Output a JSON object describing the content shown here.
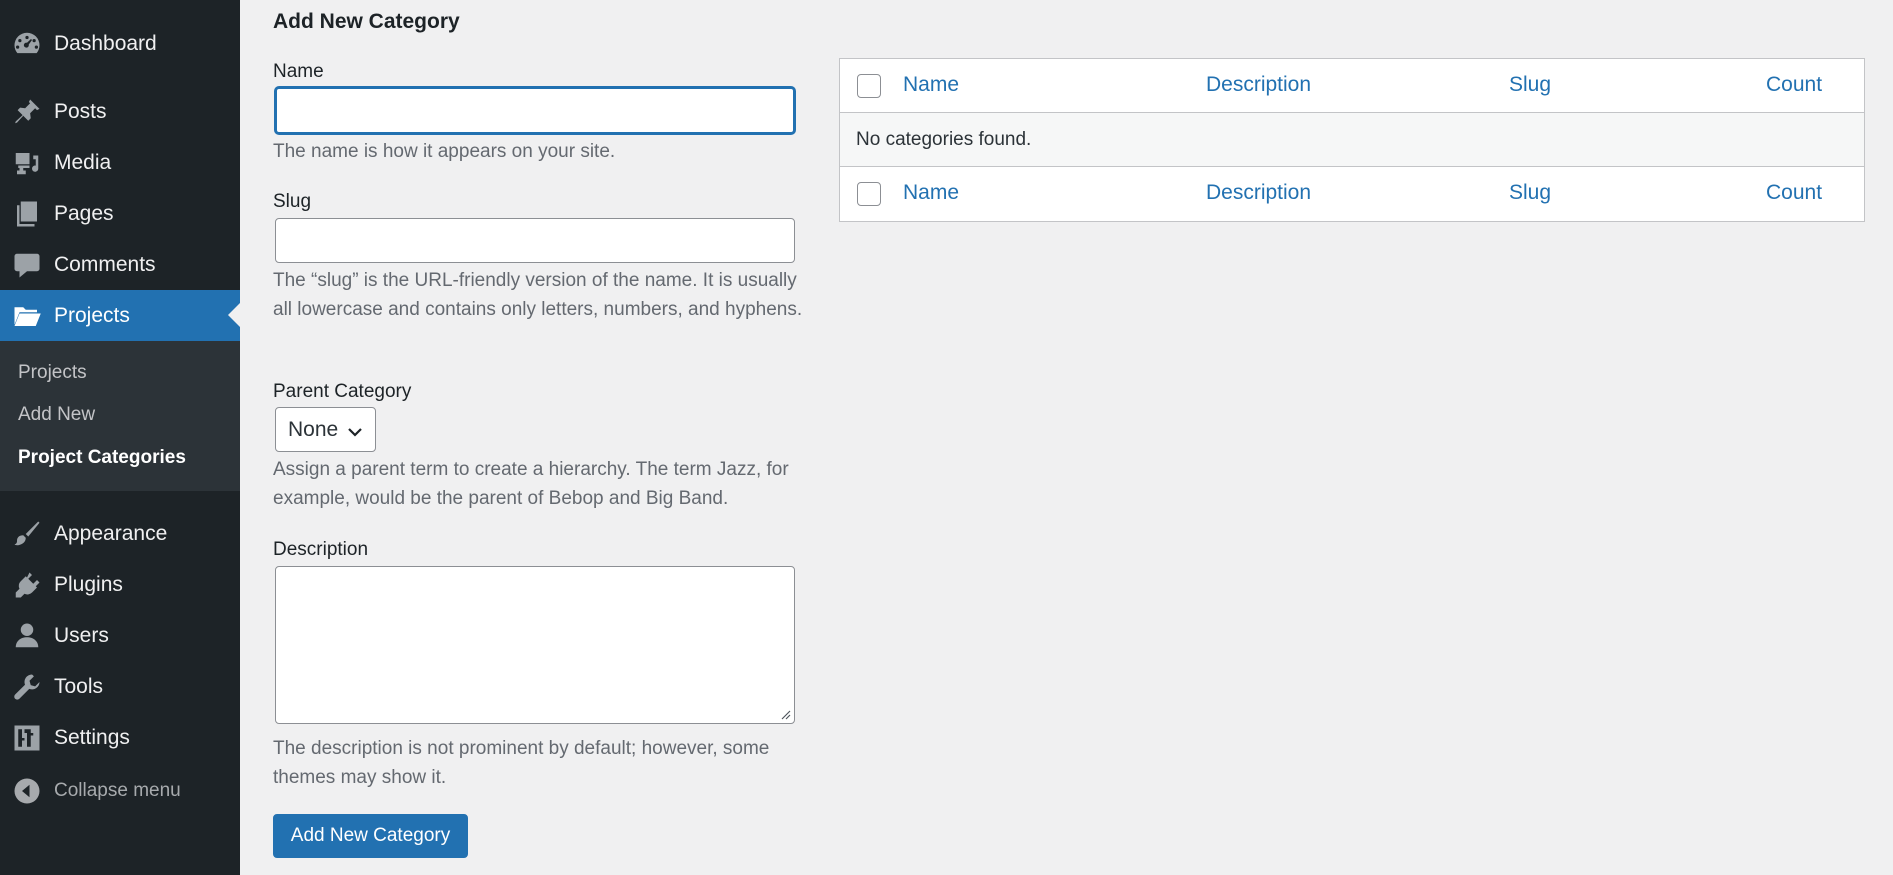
{
  "sidebar": {
    "menu": [
      {
        "label": "Dashboard",
        "icon": "dashboard-icon"
      },
      {
        "label": "Posts",
        "icon": "pin-icon"
      },
      {
        "label": "Media",
        "icon": "media-icon"
      },
      {
        "label": "Pages",
        "icon": "pages-icon"
      },
      {
        "label": "Comments",
        "icon": "comment-icon"
      },
      {
        "label": "Projects",
        "icon": "folder-icon",
        "current": true
      }
    ],
    "submenu": [
      "Projects",
      "Add New",
      "Project Categories"
    ],
    "menu2": [
      {
        "label": "Appearance",
        "icon": "brush-icon"
      },
      {
        "label": "Plugins",
        "icon": "plugin-icon"
      },
      {
        "label": "Users",
        "icon": "user-icon"
      },
      {
        "label": "Tools",
        "icon": "wrench-icon"
      },
      {
        "label": "Settings",
        "icon": "settings-icon"
      }
    ],
    "collapse_label": "Collapse menu"
  },
  "form": {
    "title": "Add New Category",
    "name_label": "Name",
    "name_value": "",
    "name_help": "The name is how it appears on your site.",
    "slug_label": "Slug",
    "slug_value": "",
    "slug_help": "The “slug” is the URL-friendly version of the name. It is usually all lowercase and contains only letters, numbers, and hyphens.",
    "parent_label": "Parent Category",
    "parent_value": "None",
    "parent_help": "Assign a parent term to create a hierarchy. The term Jazz, for example, would be the parent of Bebop and Big Band.",
    "description_label": "Description",
    "description_value": "",
    "description_help": "The description is not prominent by default; however, some themes may show it.",
    "submit_label": "Add New Category"
  },
  "table": {
    "columns": [
      "Name",
      "Description",
      "Slug",
      "Count"
    ],
    "empty_message": "No categories found."
  },
  "colors": {
    "sidebar_bg": "#1d2327",
    "submenu_bg": "#2c3338",
    "accent": "#2271b1",
    "page_bg": "#f0f0f1"
  }
}
